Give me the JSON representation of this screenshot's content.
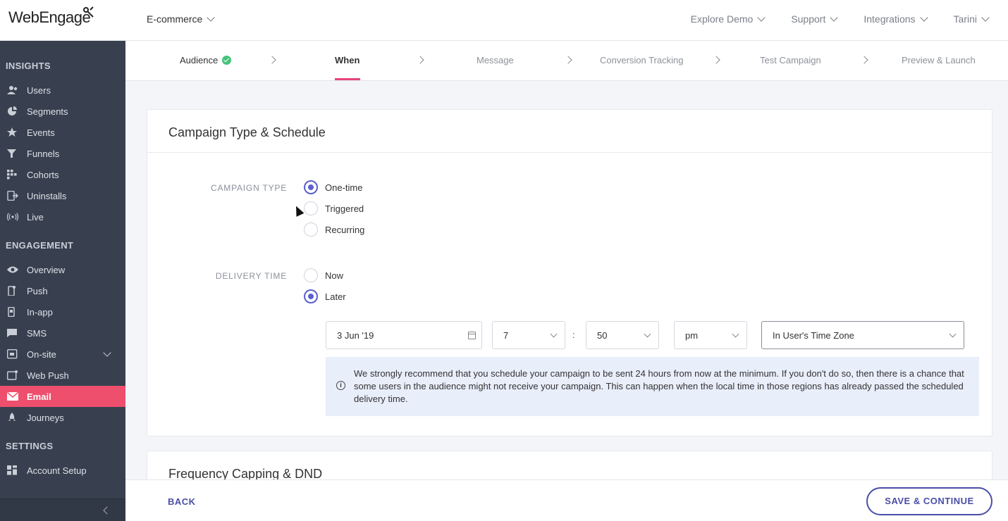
{
  "header": {
    "logo": "WebEngage",
    "project": "E-commerce",
    "nav": [
      "Explore Demo",
      "Support",
      "Integrations",
      "Tarini"
    ]
  },
  "sidebar": {
    "sections": [
      {
        "title": "INSIGHTS",
        "items": [
          "Users",
          "Segments",
          "Events",
          "Funnels",
          "Cohorts",
          "Uninstalls",
          "Live"
        ]
      },
      {
        "title": "ENGAGEMENT",
        "items": [
          "Overview",
          "Push",
          "In-app",
          "SMS",
          "On-site",
          "Web Push",
          "Email",
          "Journeys"
        ]
      },
      {
        "title": "SETTINGS",
        "items": [
          "Account Setup"
        ]
      }
    ],
    "active": "Email",
    "colors": {
      "bg": "#38404f",
      "active": "#ee4f6d"
    }
  },
  "steps": [
    "Audience",
    "When",
    "Message",
    "Conversion Tracking",
    "Test Campaign",
    "Preview & Launch"
  ],
  "current_step": "When",
  "card": {
    "title": "Campaign Type & Schedule",
    "campaign_type_label": "CAMPAIGN TYPE",
    "campaign_types": [
      "One-time",
      "Triggered",
      "Recurring"
    ],
    "campaign_type_selected": "One-time",
    "delivery_label": "DELIVERY TIME",
    "delivery_options": [
      "Now",
      "Later"
    ],
    "delivery_selected": "Later",
    "date": "3 Jun '19",
    "hour": "7",
    "colon": ":",
    "minute": "50",
    "ampm": "pm",
    "timezone": "In User's Time Zone",
    "notice": "We strongly recommend that you schedule your campaign to be sent 24 hours from now at the minimum. If you don't do so, then there is a chance that some users in the audience might not receive your campaign. This can happen when the local time in those regions has already passed the scheduled delivery time."
  },
  "card2_title": "Frequency Capping & DND",
  "footer": {
    "back": "BACK",
    "save": "SAVE & CONTINUE"
  },
  "accent": "#5b5fcf"
}
